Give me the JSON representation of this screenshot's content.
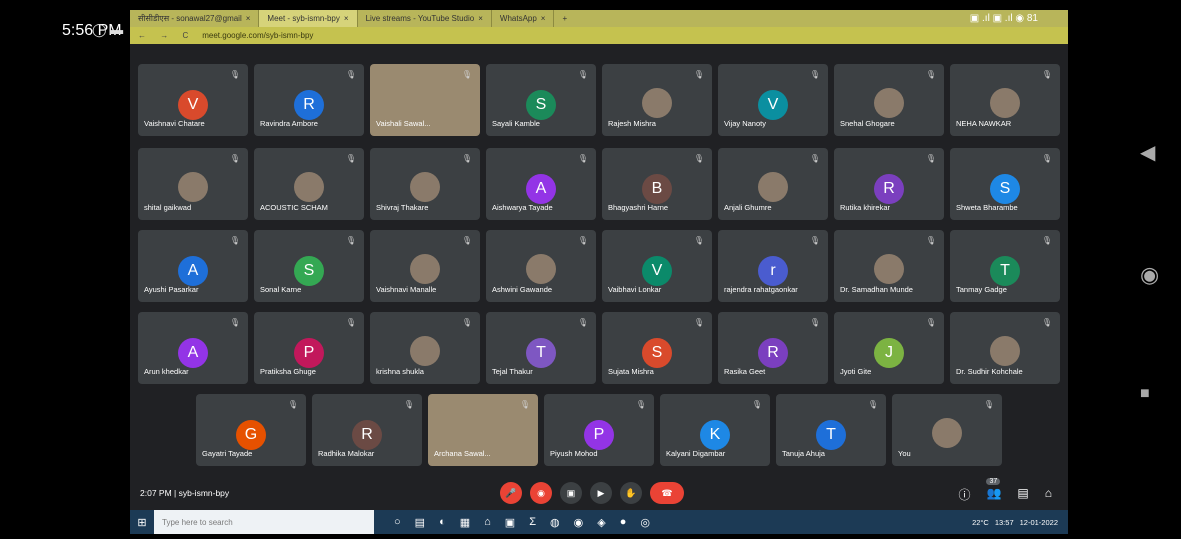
{
  "phone": {
    "time": "5:56 PM",
    "icons": "◯ ▬",
    "status_right": "▣ .ıl ▣ .ıl ◉ 81"
  },
  "browser": {
    "tabs": [
      {
        "label": "सीसीडीएस - sonawal27@gmail",
        "close": "×"
      },
      {
        "label": "Meet - syb-ismn-bpy",
        "close": "×",
        "active": true
      },
      {
        "label": "Live streams - YouTube Studio",
        "close": "×"
      },
      {
        "label": "WhatsApp",
        "close": "×"
      }
    ],
    "tab_plus": "+",
    "nav": "← → C",
    "url": "meet.google.com/syb-ismn-bpy"
  },
  "grid": {
    "rows": [
      [
        {
          "name": "Vaishnavi Chatare",
          "initial": "V",
          "color": "#d94a2c"
        },
        {
          "name": "Ravindra Ambore",
          "initial": "R",
          "color": "#1e6fd9"
        },
        {
          "name": "Vaishali Sawal...",
          "video": true
        },
        {
          "name": "Sayali Kamble",
          "initial": "S",
          "color": "#1b8a5a"
        },
        {
          "name": "Rajesh Mishra",
          "photo": true
        },
        {
          "name": "Vijay Nanoty",
          "initial": "V",
          "color": "#0b8fa0"
        },
        {
          "name": "Snehal Ghogare",
          "photo": true
        },
        {
          "name": "NEHA NAWKAR",
          "photo": true
        }
      ],
      [
        {
          "name": "shital gaikwad",
          "photo": true
        },
        {
          "name": "ACOUSTIC SCHAM",
          "photo": true
        },
        {
          "name": "Shivraj Thakare",
          "photo": true
        },
        {
          "name": "Aishwarya Tayade",
          "initial": "A",
          "color": "#9334e6"
        },
        {
          "name": "Bhagyashri Harne",
          "initial": "B",
          "color": "#6b4a44"
        },
        {
          "name": "Anjali Ghumre",
          "photo": true
        },
        {
          "name": "Rutika khirekar",
          "initial": "R",
          "color": "#7b3fbf"
        },
        {
          "name": "Shweta Bharambe",
          "initial": "S",
          "color": "#1e88e5"
        }
      ],
      [
        {
          "name": "Ayushi Pasarkar",
          "initial": "A",
          "color": "#1e6fd9"
        },
        {
          "name": "Sonal Karne",
          "initial": "S",
          "color": "#34a853"
        },
        {
          "name": "Vaishnavi Manalle",
          "photo": true
        },
        {
          "name": "Ashwini Gawande",
          "photo": true
        },
        {
          "name": "Vaibhavi Lonkar",
          "initial": "V",
          "color": "#0b8a6a"
        },
        {
          "name": "rajendra rahatgaonkar",
          "initial": "r",
          "color": "#4a5ccf"
        },
        {
          "name": "Dr. Samadhan Munde",
          "photo": true
        },
        {
          "name": "Tanmay Gadge",
          "initial": "T",
          "color": "#1b8a5a"
        }
      ],
      [
        {
          "name": "Arun khedkar",
          "initial": "A",
          "color": "#9334e6"
        },
        {
          "name": "Pratiksha Ghuge",
          "initial": "P",
          "color": "#c2185b"
        },
        {
          "name": "krishna shukla",
          "photo": true
        },
        {
          "name": "Tejal Thakur",
          "initial": "T",
          "color": "#7e57c2"
        },
        {
          "name": "Sujata Mishra",
          "initial": "S",
          "color": "#d94a2c"
        },
        {
          "name": "Rasika Geet",
          "initial": "R",
          "color": "#7b3fbf"
        },
        {
          "name": "Jyoti Gite",
          "initial": "J",
          "color": "#7cb342"
        },
        {
          "name": "Dr. Sudhir Kohchale",
          "photo": true
        }
      ],
      [
        {
          "name": "Gayatri Tayade",
          "initial": "G",
          "color": "#e65100"
        },
        {
          "name": "Radhika Malokar",
          "initial": "R",
          "color": "#6b4a44"
        },
        {
          "name": "Archana Sawal...",
          "video": true
        },
        {
          "name": "Piyush Mohod",
          "initial": "P",
          "color": "#9334e6"
        },
        {
          "name": "Kalyani Digambar",
          "initial": "K",
          "color": "#1e88e5"
        },
        {
          "name": "Tanuja Ahuja",
          "initial": "T",
          "color": "#1e6fd9"
        },
        {
          "name": "You",
          "photo": true
        }
      ]
    ]
  },
  "bottom": {
    "meeting_time": "2:07 PM",
    "separator": "|",
    "meeting_code": "syb-ismn-bpy",
    "controls": [
      "🎤",
      "◉",
      "▣",
      "▶",
      "✋",
      "☎"
    ],
    "right": [
      "ⓘ",
      "👥",
      "▤",
      "⌂"
    ],
    "participants_badge": "37"
  },
  "taskbar": {
    "start": "⊞",
    "search_placeholder": "Type here to search",
    "icons": [
      "○",
      "▤",
      "◐",
      "▦",
      "⌂",
      "▣",
      "Σ",
      "◍",
      "◉",
      "◈",
      "●",
      "◎"
    ],
    "weather": "22°C",
    "time": "13:57",
    "date": "12-01-2022"
  }
}
